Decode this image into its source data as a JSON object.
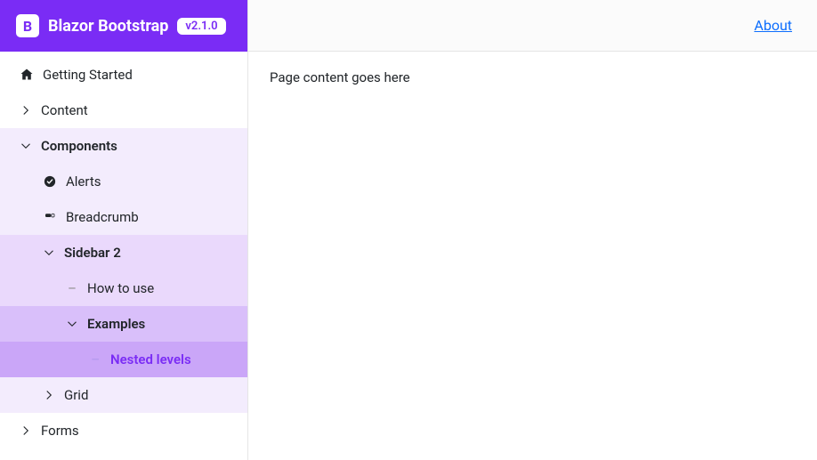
{
  "brand": {
    "icon_letter": "B",
    "title": "Blazor Bootstrap",
    "version": "v2.1.0"
  },
  "topbar": {
    "about_label": "About"
  },
  "content": {
    "body": "Page content goes here"
  },
  "sidebar": {
    "getting_started": "Getting Started",
    "content": "Content",
    "components": "Components",
    "alerts": "Alerts",
    "breadcrumb": "Breadcrumb",
    "sidebar2": "Sidebar 2",
    "how_to_use": "How to use",
    "examples": "Examples",
    "nested_levels": "Nested levels",
    "grid": "Grid",
    "forms": "Forms"
  }
}
